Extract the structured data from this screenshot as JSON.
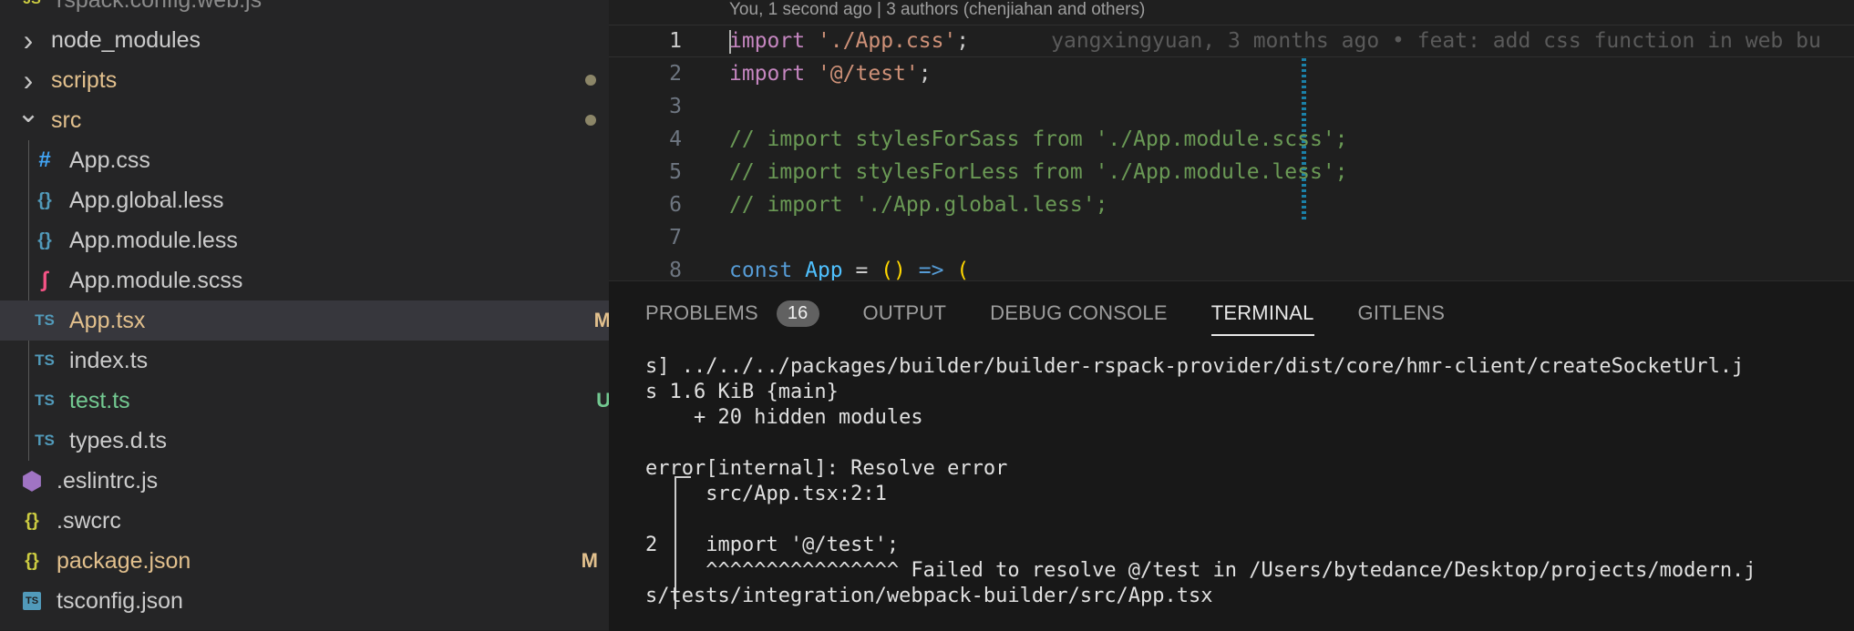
{
  "sidebar": {
    "items": [
      {
        "label": "rspack.config.web.js",
        "type": "js",
        "color": "#cccccc",
        "badge": "",
        "dot": false
      },
      {
        "label": "node_modules",
        "type": "folder",
        "expanded": false,
        "color": "#cccccc",
        "badge": "",
        "dot": false
      },
      {
        "label": "scripts",
        "type": "folder",
        "expanded": false,
        "color": "#e2c08d",
        "badge": "",
        "dot": true
      },
      {
        "label": "src",
        "type": "folder",
        "expanded": true,
        "color": "#e2c08d",
        "badge": "",
        "dot": true
      },
      {
        "label": "App.css",
        "type": "css",
        "color": "#cccccc",
        "badge": "",
        "dot": false
      },
      {
        "label": "App.global.less",
        "type": "braces",
        "color": "#cccccc",
        "badge": "",
        "dot": false
      },
      {
        "label": "App.module.less",
        "type": "braces",
        "color": "#cccccc",
        "badge": "",
        "dot": false
      },
      {
        "label": "App.module.scss",
        "type": "sass",
        "color": "#cccccc",
        "badge": "",
        "dot": false
      },
      {
        "label": "App.tsx",
        "type": "ts",
        "color": "#e2c08d",
        "badge": "M",
        "dot": false,
        "selected": true
      },
      {
        "label": "index.ts",
        "type": "ts",
        "color": "#cccccc",
        "badge": "",
        "dot": false
      },
      {
        "label": "test.ts",
        "type": "ts",
        "color": "#73c991",
        "badge": "U",
        "dot": false
      },
      {
        "label": "types.d.ts",
        "type": "ts",
        "color": "#cccccc",
        "badge": "",
        "dot": false
      },
      {
        "label": ".eslintrc.js",
        "type": "eslint",
        "color": "#cccccc",
        "badge": "",
        "dot": false
      },
      {
        "label": ".swcrc",
        "type": "json",
        "color": "#cccccc",
        "badge": "",
        "dot": false
      },
      {
        "label": "package.json",
        "type": "json",
        "color": "#e2c08d",
        "badge": "M",
        "dot": false
      },
      {
        "label": "tsconfig.json",
        "type": "tsconfig",
        "color": "#cccccc",
        "badge": "",
        "dot": false
      }
    ],
    "icons": {
      "ts": "TS",
      "css": "#",
      "braces": "{}",
      "sass": "ʃ",
      "json": "{}",
      "tsconfig": "TS",
      "eslint": "⬢"
    }
  },
  "editor": {
    "blame_header": "You, 1 second ago | 3 authors (chenjiahan and others)",
    "inline_blame": "yangxingyuan, 3 months ago • feat: add css function in web bu",
    "lines": [
      {
        "num": "1",
        "tokens": [
          [
            "kw",
            "import"
          ],
          [
            "punct",
            " "
          ],
          [
            "str",
            "'./App.css'"
          ],
          [
            "punct",
            ";"
          ]
        ]
      },
      {
        "num": "2",
        "tokens": [
          [
            "kw",
            "import"
          ],
          [
            "punct",
            " "
          ],
          [
            "str",
            "'@/test'"
          ],
          [
            "punct",
            ";"
          ]
        ]
      },
      {
        "num": "3",
        "tokens": []
      },
      {
        "num": "4",
        "tokens": [
          [
            "cmt",
            "// import stylesForSass from './App.module.scss';"
          ]
        ]
      },
      {
        "num": "5",
        "tokens": [
          [
            "cmt",
            "// import stylesForLess from './App.module.less';"
          ]
        ]
      },
      {
        "num": "6",
        "tokens": [
          [
            "cmt",
            "// import './App.global.less';"
          ]
        ]
      },
      {
        "num": "7",
        "tokens": []
      },
      {
        "num": "8",
        "tokens": [
          [
            "const-kw",
            "const"
          ],
          [
            "punct",
            " "
          ],
          [
            "ident",
            "App"
          ],
          [
            "punct",
            " = "
          ],
          [
            "bracket",
            "()"
          ],
          [
            "punct",
            " "
          ],
          [
            "const-kw",
            "=>"
          ],
          [
            "punct",
            " "
          ],
          [
            "bracket",
            "("
          ]
        ]
      }
    ]
  },
  "panel": {
    "tabs": [
      {
        "label": "PROBLEMS",
        "count": "16",
        "active": false
      },
      {
        "label": "OUTPUT",
        "count": "",
        "active": false
      },
      {
        "label": "DEBUG CONSOLE",
        "count": "",
        "active": false
      },
      {
        "label": "TERMINAL",
        "count": "",
        "active": true
      },
      {
        "label": "GITLENS",
        "count": "",
        "active": false
      }
    ],
    "terminal_lines": [
      "s] ../../../packages/builder/builder-rspack-provider/dist/core/hmr-client/createSocketUrl.j",
      "s 1.6 KiB {main}",
      "    + 20 hidden modules",
      "",
      "error[internal]: Resolve error",
      "     src/App.tsx:2:1",
      "",
      "2    import '@/test';",
      "     ^^^^^^^^^^^^^^^^ Failed to resolve @/test in /Users/bytedance/Desktop/projects/modern.j",
      "s/tests/integration/webpack-builder/src/App.tsx"
    ]
  },
  "colors": {
    "accent_blue": "#1b81a8",
    "modified": "#e2c08d",
    "untracked": "#73c991",
    "ts_icon": "#519aba",
    "css_icon": "#42a5f5",
    "braces_icon": "#519aba",
    "json_icon": "#cbcb41",
    "sass_icon": "#f55385",
    "eslint_icon": "#a074c4"
  }
}
